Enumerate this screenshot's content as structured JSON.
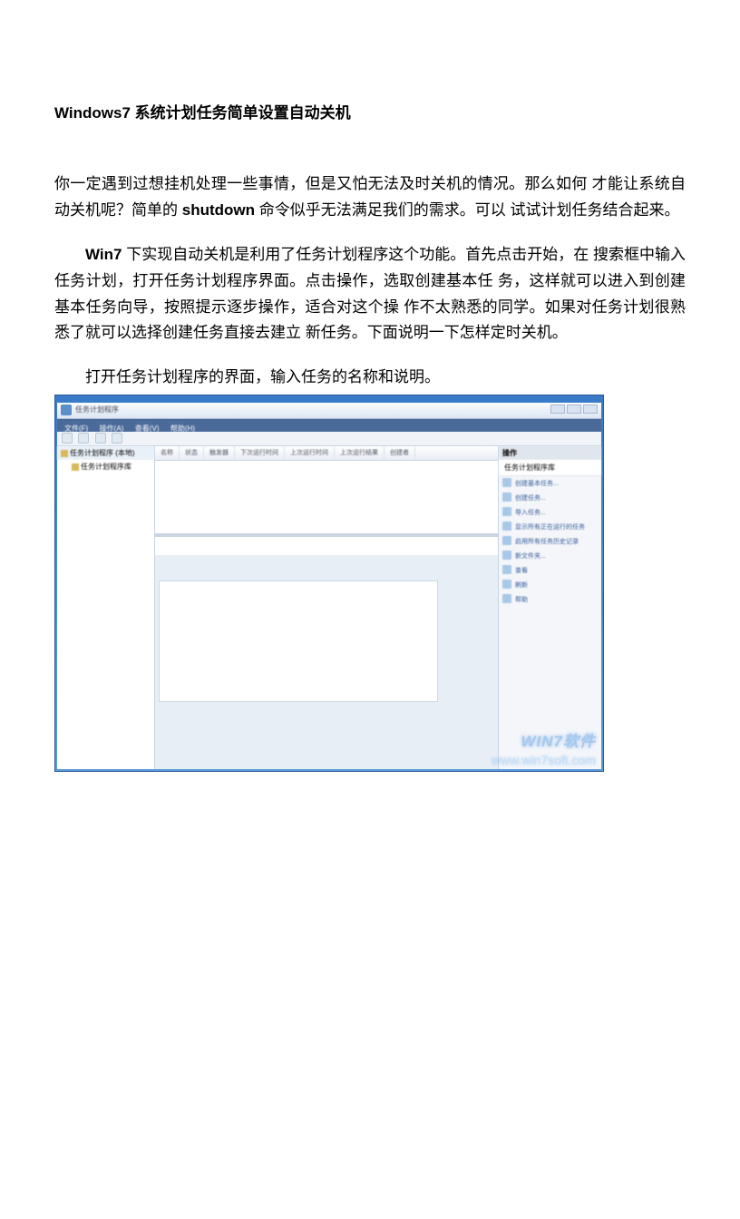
{
  "title": "Windows7 系统计划任务简单设置自动关机",
  "para1_a": "你一定遇到过想挂机处理一些事情，但是又怕无法及时关机的情况。那么如何 才能让系统自动关机呢？简单的 ",
  "para1_bold": "shutdown",
  "para1_b": " 命令似乎无法满足我们的需求。可以 试试计划任务结合起来。",
  "para2_bold": "Win7",
  "para2_rest": " 下实现自动关机是利用了任务计划程序这个功能。首先点击开始，在 搜索框中输入任务计划，打开任务计划程序界面。点击操作，选取创建基本任 务，这样就可以进入到创建基本任务向导，按照提示逐步操作，适合对这个操 作不太熟悉的同学。如果对任务计划很熟悉了就可以选择创建任务直接去建立 新任务。下面说明一下怎样定时关机。",
  "caption": "打开任务计划程序的界面，输入任务的名称和说明。",
  "screenshot": {
    "titlebar": "任务计划程序",
    "menu": [
      "文件(F)",
      "操作(A)",
      "查看(V)",
      "帮助(H)"
    ],
    "tree": {
      "root": "任务计划程序 (本地)",
      "child": "任务计划程序库"
    },
    "columns": [
      "名称",
      "状态",
      "触发器",
      "下次运行时间",
      "上次运行时间",
      "上次运行结果",
      "创建者"
    ],
    "actions": {
      "header": "操作",
      "title": "任务计划程序库",
      "items": [
        "创建基本任务...",
        "创建任务...",
        "导入任务...",
        "显示所有正在运行的任务",
        "启用所有任务历史记录",
        "新文件夹...",
        "查看",
        "刷新",
        "帮助"
      ]
    },
    "watermark1": "WIN7软件",
    "watermark2": "www.win7soft.com"
  }
}
